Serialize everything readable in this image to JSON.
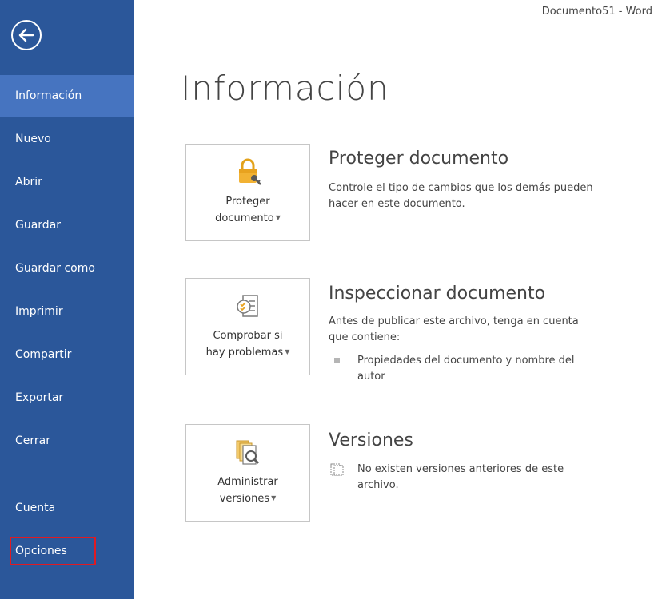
{
  "window": {
    "title": "Documento51 - Word"
  },
  "sidebar": {
    "back_icon": "arrow-left-circle-icon",
    "items": [
      {
        "label": "Información"
      },
      {
        "label": "Nuevo"
      },
      {
        "label": "Abrir"
      },
      {
        "label": "Guardar"
      },
      {
        "label": "Guardar como"
      },
      {
        "label": "Imprimir"
      },
      {
        "label": "Compartir"
      },
      {
        "label": "Exportar"
      },
      {
        "label": "Cerrar"
      },
      {
        "label": "Cuenta"
      },
      {
        "label": "Opciones"
      }
    ],
    "active_item": "Información",
    "highlighted_item": "Opciones",
    "colors": {
      "background": "#2b579a",
      "active": "#4674c0",
      "highlight_border": "#e01a22"
    }
  },
  "main": {
    "title": "Información",
    "sections": [
      {
        "button_line1": "Proteger",
        "button_line2": "documento",
        "button_icon": "lock-key-icon",
        "title": "Proteger documento",
        "description": "Controle el tipo de cambios que los demás pueden hacer en este documento."
      },
      {
        "button_line1": "Comprobar si",
        "button_line2": "hay problemas",
        "button_icon": "inspect-checklist-icon",
        "title": "Inspeccionar documento",
        "description": "Antes de publicar este archivo, tenga en cuenta que contiene:",
        "bullet": "Propiedades del documento y nombre del autor"
      },
      {
        "button_line1": "Administrar",
        "button_line2": "versiones",
        "button_icon": "versions-magnifier-icon",
        "title": "Versiones",
        "bullet": "No existen versiones anteriores de este archivo."
      }
    ]
  }
}
